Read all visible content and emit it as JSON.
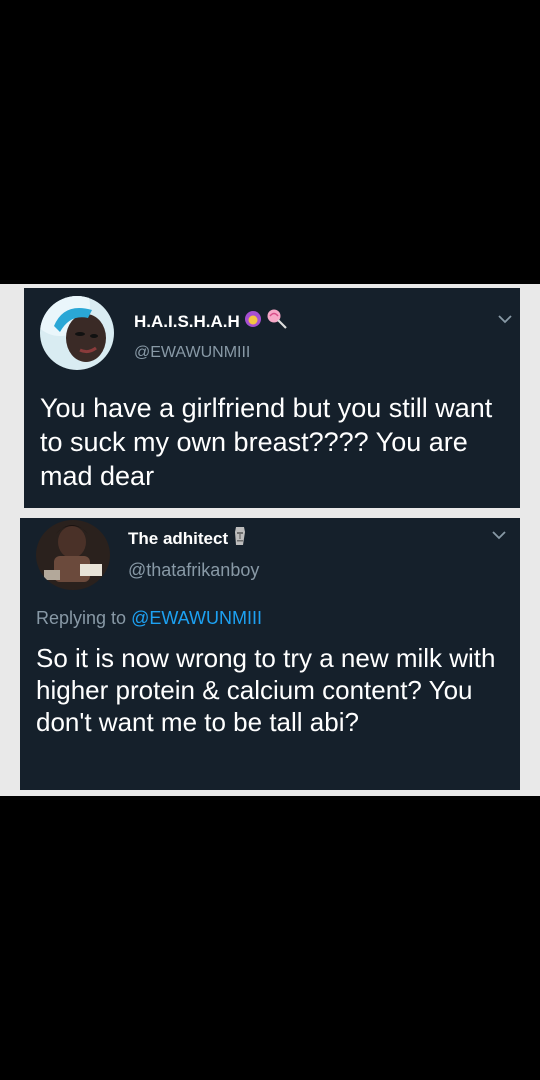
{
  "tweets": [
    {
      "name": "H.A.I.S.H.A.H",
      "handle": "@EWAWUNMIII",
      "text": "You have a girlfriend but you still want to suck my own breast???? You are mad dear",
      "icons": [
        "person-with-headscarf-emoji",
        "lollipop-emoji"
      ]
    },
    {
      "name": "The adhitect",
      "handle": "@thatafrikanboy",
      "reply_prefix": "Replying to ",
      "reply_to": "@EWAWUNMIII",
      "text": "So it is now wrong to try a new milk with higher protein & calcium content? You don't want me to be tall abi?",
      "icons": [
        "moai-emoji"
      ]
    }
  ],
  "colors": {
    "background": "#000000",
    "band": "#e9e9e9",
    "tweet_bg": "#15202b",
    "text": "#ffffff",
    "secondary": "#8899a6",
    "link": "#1da1f2"
  }
}
